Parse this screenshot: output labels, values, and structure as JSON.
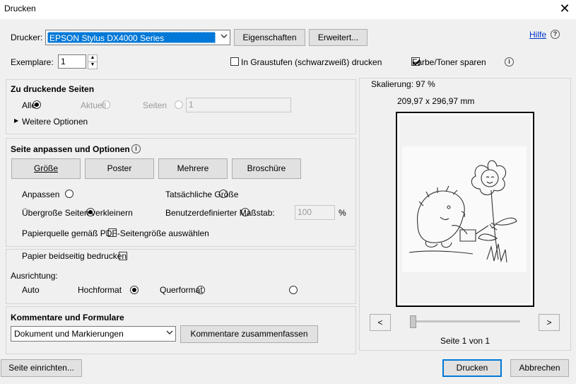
{
  "window": {
    "title": "Drucken",
    "close_glyph": "✕"
  },
  "printer": {
    "label": "Drucker:",
    "selected": "EPSON Stylus DX4000 Series",
    "properties_button": "Eigenschaften",
    "advanced_button": "Erweitert...",
    "help_link": "Hilfe",
    "help_glyph": "?"
  },
  "copies": {
    "label": "Exemplare:",
    "value": "1",
    "grayscale_label": "In Graustufen (schwarzweiß) drucken",
    "grayscale_checked": false,
    "save_toner_label": "Farbe/Toner sparen",
    "save_toner_checked": true,
    "info_glyph": "i"
  },
  "pages_section": {
    "title": "Zu druckende Seiten",
    "option_all": "Alle",
    "option_current": "Aktuell",
    "option_pages": "Seiten",
    "pages_value": "1",
    "more_options": "Weitere Optionen",
    "more_glyph": "▶"
  },
  "fit_section": {
    "title": "Seite anpassen und Optionen",
    "info_glyph": "i",
    "buttons": {
      "size": "Größe",
      "poster": "Poster",
      "multiple": "Mehrere",
      "booklet": "Broschüre"
    },
    "fit": "Anpassen",
    "actual_size": "Tatsächliche Größe",
    "shrink_oversized": "Übergroße Seiten verkleinern",
    "custom_scale": "Benutzerdefinierter Maßstab:",
    "custom_scale_value": "100",
    "percent": "%",
    "paper_source": "Papierquelle gemäß PDF-Seitengröße auswählen"
  },
  "duplex_section": {
    "duplex_label": "Papier beidseitig bedrucken",
    "orientation_label": "Ausrichtung:",
    "auto": "Auto",
    "portrait": "Hochformat",
    "landscape": "Querformat"
  },
  "comments_section": {
    "title": "Kommentare und Formulare",
    "selected": "Dokument und Markierungen",
    "summarize_button": "Kommentare zusammenfassen"
  },
  "preview": {
    "scaling": "Skalierung:  97 %",
    "dimensions": "209,97 x 296,97 mm",
    "prev": "<",
    "next": ">",
    "page_info": "Seite 1 von 1",
    "slider_position": 0
  },
  "footer": {
    "page_setup": "Seite einrichten...",
    "print": "Drucken",
    "cancel": "Abbrechen"
  }
}
